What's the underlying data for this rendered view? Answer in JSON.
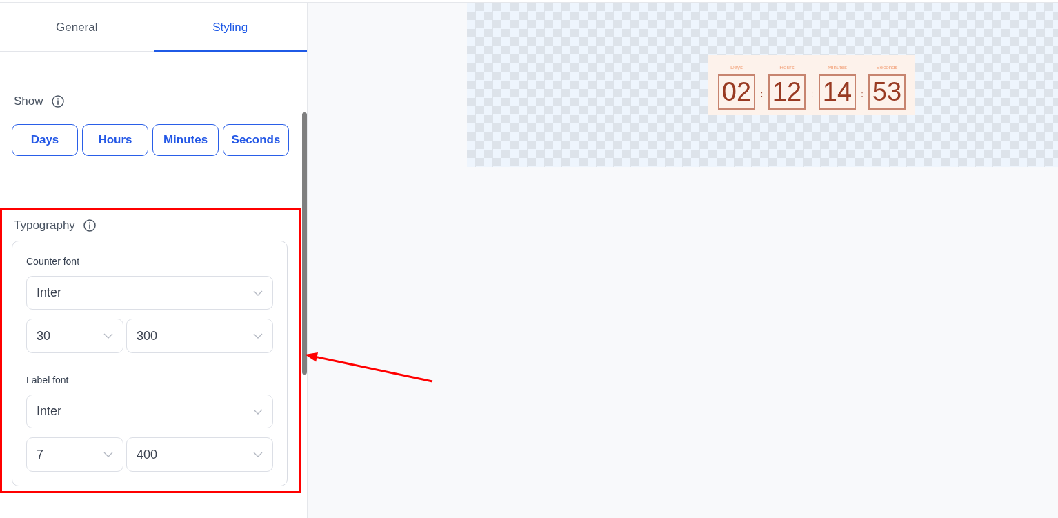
{
  "tabs": [
    {
      "label": "General",
      "selected": false
    },
    {
      "label": "Styling",
      "selected": true
    }
  ],
  "show": {
    "label": "Show",
    "units": [
      {
        "label": "Days",
        "on": true
      },
      {
        "label": "Hours",
        "on": true
      },
      {
        "label": "Minutes",
        "on": true
      },
      {
        "label": "Seconds",
        "on": true
      }
    ]
  },
  "typography": {
    "label": "Typography",
    "groups": [
      {
        "label": "Counter font",
        "family": "Inter",
        "size": "30",
        "weight": "300"
      },
      {
        "label": "Label font",
        "family": "Inter",
        "size": "7",
        "weight": "400"
      }
    ]
  },
  "preview": {
    "units": [
      {
        "label": "Days",
        "value": "02"
      },
      {
        "label": "Hours",
        "value": "12"
      },
      {
        "label": "Minutes",
        "value": "14"
      },
      {
        "label": "Seconds",
        "value": "53"
      }
    ],
    "separators": [
      ":",
      ":",
      ":"
    ]
  }
}
